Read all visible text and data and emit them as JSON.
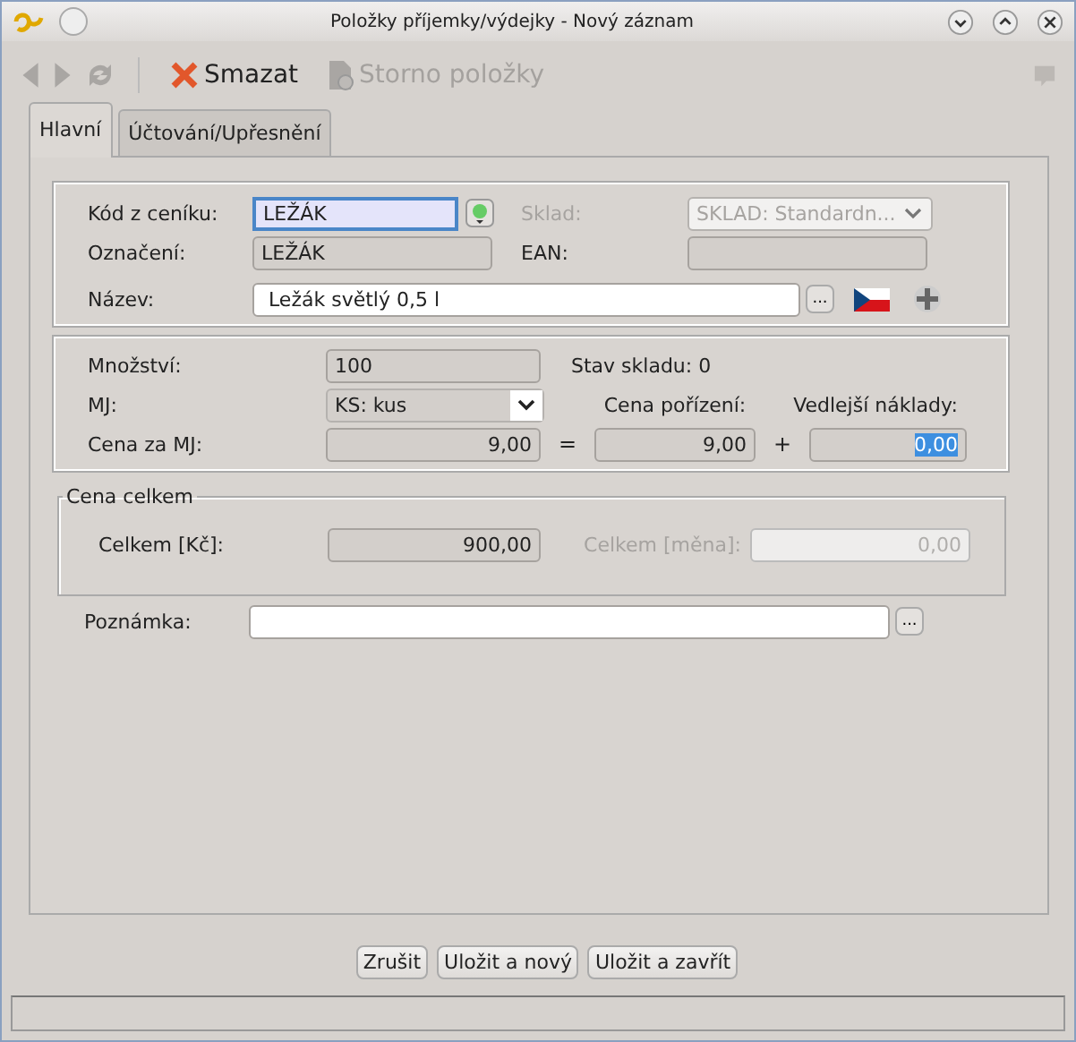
{
  "window": {
    "title": "Položky příjemky/výdejky - Nový záznam"
  },
  "toolbar": [
    {
      "kind": "back",
      "disabled": true
    },
    {
      "kind": "forward",
      "disabled": true
    },
    {
      "kind": "refresh",
      "disabled": true
    },
    {
      "kind": "delete",
      "label": "Smazat",
      "disabled": false
    },
    {
      "kind": "cancel",
      "label": "Storno položky",
      "disabled": true
    }
  ],
  "tabs": [
    {
      "label": "Hlavní",
      "selected": true
    },
    {
      "label": "Účtování/Upřesnění",
      "selected": false
    }
  ],
  "item": {
    "code": {
      "label": "Kód z ceníku:",
      "value": "LEŽÁK",
      "kind": "focus"
    },
    "warehouse": {
      "label": "Sklad:",
      "value": "SKLAD: Standardn...",
      "disabled": true
    },
    "designation": {
      "label": "Označení:",
      "value": "LEŽÁK",
      "kind": "readonly"
    },
    "ean": {
      "label": "EAN:",
      "kind": "readonly"
    },
    "name": {
      "label": "Název:",
      "value": "Ležák světlý 0,5 l",
      "kind": "edit"
    },
    "name_button": "..."
  },
  "quantity": {
    "amount": {
      "label": "Množství:",
      "value": "100",
      "kind": "readonly"
    },
    "stock": "Stav skladu: 0",
    "unit": {
      "label": "MJ:",
      "value": "KS: kus"
    },
    "unit_price": {
      "label": "Cena za MJ:",
      "value": "9,00",
      "kind": "readonly"
    },
    "equals": "=",
    "purchase_price": {
      "label": "Cena pořízení:",
      "value": "9,00",
      "kind": "readonly"
    },
    "plus": "+",
    "side_costs": {
      "label": "Vedlejší náklady:",
      "value": "0,00",
      "kind": "selection"
    }
  },
  "total": {
    "title": "Cena celkem",
    "czk": {
      "label": "Celkem [Kč]:",
      "value": "900,00",
      "kind": "readonly"
    },
    "currency": {
      "label": "Celkem [měna]:",
      "value": "0,00",
      "kind": "disabled"
    }
  },
  "note": {
    "label": "Poznámka:",
    "kind": "edit",
    "button": "..."
  },
  "buttons": [
    "Zrušit",
    "Uložit a nový",
    "Uložit a zavřít"
  ]
}
